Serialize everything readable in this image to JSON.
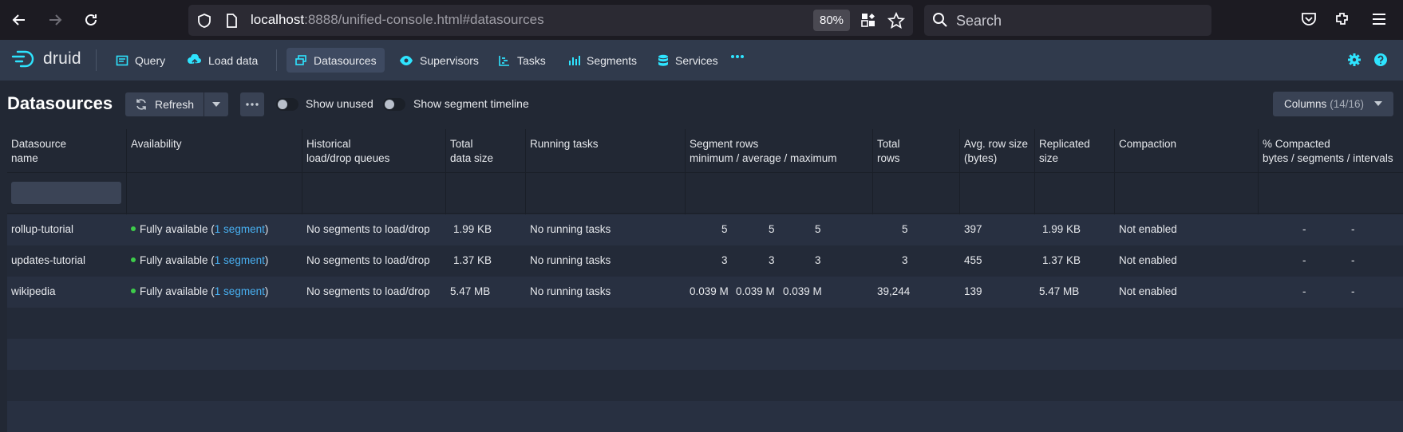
{
  "browser": {
    "url_host": "localhost",
    "url_rest": ":8888/unified-console.html#datasources",
    "zoom": "80%",
    "search_placeholder": "Search"
  },
  "app": {
    "logo_text": "druid",
    "nav": [
      {
        "label": "Query",
        "icon": "query-icon"
      },
      {
        "label": "Load data",
        "icon": "upload-icon"
      },
      {
        "label": "Datasources",
        "icon": "datasources-icon",
        "active": true
      },
      {
        "label": "Supervisors",
        "icon": "eye-icon"
      },
      {
        "label": "Tasks",
        "icon": "tasks-icon"
      },
      {
        "label": "Segments",
        "icon": "segments-icon"
      },
      {
        "label": "Services",
        "icon": "database-icon"
      }
    ]
  },
  "toolbar": {
    "title": "Datasources",
    "refresh_label": "Refresh",
    "show_unused_label": "Show unused",
    "show_timeline_label": "Show segment timeline",
    "columns_label": "Columns",
    "columns_count": "(14/16)"
  },
  "table": {
    "headers": [
      [
        "Datasource",
        "name"
      ],
      [
        "Availability",
        ""
      ],
      [
        "Historical",
        "load/drop queues"
      ],
      [
        "Total",
        "data size"
      ],
      [
        "Running tasks",
        ""
      ],
      [
        "Segment rows",
        "minimum / average / maximum"
      ],
      [
        "Total",
        "rows"
      ],
      [
        "Avg. row size",
        "(bytes)"
      ],
      [
        "Replicated",
        "size"
      ],
      [
        "Compaction",
        ""
      ],
      [
        "% Compacted",
        "bytes / segments / intervals"
      ]
    ],
    "rows": [
      {
        "name": "rollup-tutorial",
        "availability_prefix": "Fully available (",
        "availability_link": "1 segment",
        "availability_suffix": ")",
        "queues": "No segments to load/drop",
        "total_size": "1.99 KB",
        "running_tasks": "No running tasks",
        "seg_min": "5",
        "seg_avg": "5",
        "seg_max": "5",
        "total_rows": "5",
        "avg_row_size": "397",
        "replicated_size": "1.99 KB",
        "compaction": "Not enabled",
        "compacted_bytes": "-",
        "compacted_segments": "-"
      },
      {
        "name": "updates-tutorial",
        "availability_prefix": "Fully available (",
        "availability_link": "1 segment",
        "availability_suffix": ")",
        "queues": "No segments to load/drop",
        "total_size": "1.37 KB",
        "running_tasks": "No running tasks",
        "seg_min": "3",
        "seg_avg": "3",
        "seg_max": "3",
        "total_rows": "3",
        "avg_row_size": "455",
        "replicated_size": "1.37 KB",
        "compaction": "Not enabled",
        "compacted_bytes": "-",
        "compacted_segments": "-"
      },
      {
        "name": "wikipedia",
        "availability_prefix": "Fully available (",
        "availability_link": "1 segment",
        "availability_suffix": ")",
        "queues": "No segments to load/drop",
        "total_size": "5.47 MB",
        "running_tasks": "No running tasks",
        "seg_min": "0.039 M",
        "seg_avg": "0.039 M",
        "seg_max": "0.039 M",
        "total_rows": "39,244",
        "avg_row_size": "139",
        "replicated_size": "5.47 MB",
        "compaction": "Not enabled",
        "compacted_bytes": "-",
        "compacted_segments": "-"
      }
    ]
  },
  "colors": {
    "accent": "#2ee4ff",
    "link": "#48aff0",
    "available_dot": "#3dcc4a"
  }
}
